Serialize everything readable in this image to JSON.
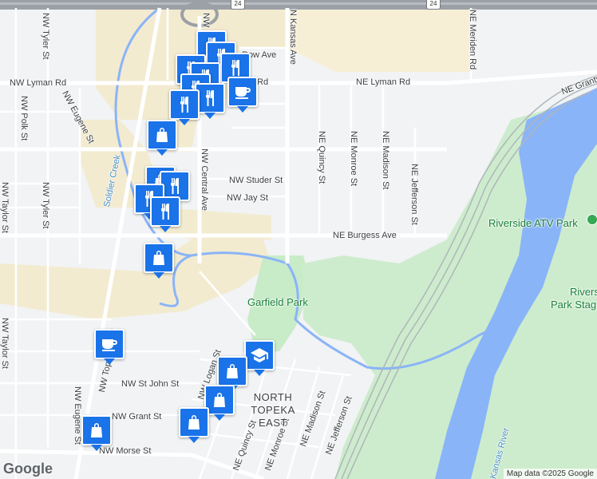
{
  "streets": {
    "nw_tyler_top": "NW Tyler St",
    "nw_polk": "NW Polk St",
    "nw_eugene_top": "NW Eugene St",
    "nw_lyman": "NW Lyman Rd",
    "ne_lyman": "NE Lyman Rd",
    "rd_fragment": "Rd",
    "row_ave": "Row Ave",
    "n_kansas": "N Kansas Ave",
    "ne_meriden": "NE Meriden Rd",
    "ne_grantville": "NE Grantv",
    "nw_central": "NW Central Ave",
    "nw_studer": "NW Studer St",
    "nw_jay": "NW Jay St",
    "ne_quincy_top": "NE Quincy St",
    "ne_monroe_top": "NE Monroe St",
    "ne_madison_top": "NE Madison St",
    "ne_jefferson_top": "NE Jefferson St",
    "ne_burgess": "NE Burgess Ave",
    "nw_tyler_mid": "NW Tyler St",
    "nw_taylor_top": "NW Taylor St",
    "nw_taylor_bottom": "NW Taylor St",
    "nw_topeka": "NW Topeka Blvd",
    "nw_logan": "NW Logan St",
    "nw_st_john": "NW St John St",
    "nw_grant": "NW Grant St",
    "nw_eugene_bottom": "NW Eugene St",
    "nw_morse": "NW Morse St",
    "ne_quincy_bottom": "NE Quincy St",
    "ne_monroe_bottom": "NE Monroe St",
    "ne_madison_bottom": "NE Madison St",
    "ne_jefferson_bottom": "NE Jefferson St",
    "nw_w_top": "NW"
  },
  "areas": {
    "neighborhood": "NORTH TOPEKA EAST",
    "garfield_park": "Garfield Park",
    "riverside_atv": "Riverside ATV Park",
    "riverside_stage_1": "Rivers",
    "riverside_stage_2": "Park Stag",
    "soldier_creek": "Soldier Creek",
    "kansas_river": "Kansas River"
  },
  "highway_shield": "24",
  "attribution": "Map data ©2025 Google",
  "logo": "Google",
  "pins": [
    {
      "type": "restaurant",
      "icon": "fork-knife-icon"
    },
    {
      "type": "restaurant",
      "icon": "fork-knife-icon"
    },
    {
      "type": "restaurant",
      "icon": "fork-knife-icon"
    },
    {
      "type": "restaurant",
      "icon": "fork-knife-icon"
    },
    {
      "type": "restaurant",
      "icon": "fork-knife-icon"
    },
    {
      "type": "restaurant",
      "icon": "fork-knife-icon"
    },
    {
      "type": "cafe",
      "icon": "coffee-cup-icon"
    },
    {
      "type": "restaurant",
      "icon": "fork-knife-icon"
    },
    {
      "type": "restaurant",
      "icon": "fork-knife-icon"
    },
    {
      "type": "shopping",
      "icon": "shopping-bag-icon"
    },
    {
      "type": "shopping",
      "icon": "shopping-bag-icon"
    },
    {
      "type": "restaurant",
      "icon": "fork-knife-icon"
    },
    {
      "type": "restaurant",
      "icon": "fork-knife-icon"
    },
    {
      "type": "restaurant",
      "icon": "fork-knife-icon"
    },
    {
      "type": "shopping",
      "icon": "shopping-bag-icon"
    },
    {
      "type": "cafe",
      "icon": "coffee-cup-icon"
    },
    {
      "type": "school",
      "icon": "graduation-cap-icon"
    },
    {
      "type": "shopping",
      "icon": "shopping-bag-icon"
    },
    {
      "type": "shopping",
      "icon": "shopping-bag-icon"
    },
    {
      "type": "shopping",
      "icon": "shopping-bag-icon"
    },
    {
      "type": "shopping",
      "icon": "shopping-bag-icon"
    }
  ],
  "colors": {
    "water": "#8ab4f8",
    "park": "#c8ebc8",
    "commercial": "#f5ecd0",
    "pin": "#1a73e8",
    "highway": "#9aa0a6"
  }
}
